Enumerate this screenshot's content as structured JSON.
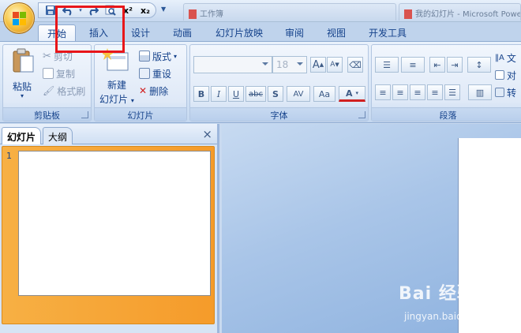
{
  "title_bar": {
    "window_tabs": [
      "工作簿",
      "我的幻灯片 - Microsoft PowerPoint"
    ]
  },
  "ribbon_tabs": [
    {
      "label": "开始",
      "active": true
    },
    {
      "label": "插入",
      "active": false
    },
    {
      "label": "设计",
      "active": false
    },
    {
      "label": "动画",
      "active": false
    },
    {
      "label": "幻灯片放映",
      "active": false
    },
    {
      "label": "审阅",
      "active": false
    },
    {
      "label": "视图",
      "active": false
    },
    {
      "label": "开发工具",
      "active": false
    }
  ],
  "ribbon": {
    "clipboard": {
      "label": "剪贴板",
      "paste": "粘贴",
      "cut": "剪切",
      "copy": "复制",
      "format_painter": "格式刷"
    },
    "slides": {
      "label": "幻灯片",
      "new_slide_line1": "新建",
      "new_slide_line2": "幻灯片",
      "layout": "版式",
      "reset": "重设",
      "delete": "删除"
    },
    "font": {
      "label": "字体",
      "font_name": "",
      "font_size": "18",
      "bold": "B",
      "italic": "I",
      "underline": "U",
      "strike": "abc",
      "shadow": "S",
      "spacing": "AV",
      "case": "Aa",
      "color": "A",
      "grow": "A",
      "shrink": "A"
    },
    "paragraph": {
      "label": "段落",
      "text_direction": "文",
      "align_text": "对",
      "convert": "转"
    }
  },
  "left_panel": {
    "tabs": [
      {
        "label": "幻灯片",
        "active": true
      },
      {
        "label": "大纲",
        "active": false
      }
    ],
    "close": "×",
    "slide_number": "1"
  },
  "watermark": {
    "brand": "Bai 经验",
    "url": "jingyan.baidu.com"
  },
  "colors": {
    "highlight_box": "#e8161a",
    "selected_slide": "#f59b2a",
    "ribbon_text": "#15428b"
  }
}
